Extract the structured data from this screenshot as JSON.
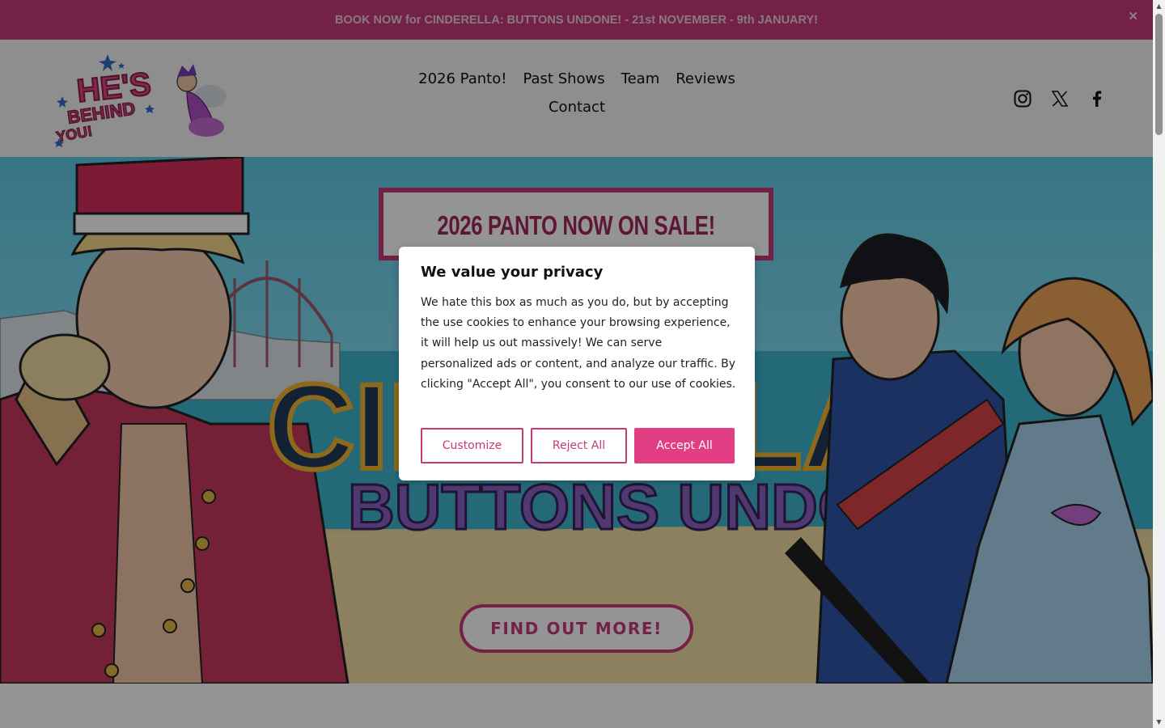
{
  "announcement": {
    "text": "BOOK NOW for CINDERELLA: BUTTONS UNDONE! - 21st NOVEMBER - 9th JANUARY!",
    "close_icon": "close-icon"
  },
  "header": {
    "logo_text": [
      "HE'S",
      "BEHIND",
      "YOU!"
    ],
    "nav": [
      "2026 Panto!",
      "Past Shows",
      "Team",
      "Reviews",
      "Contact"
    ],
    "socials": [
      "instagram-icon",
      "x-icon",
      "facebook-icon"
    ]
  },
  "hero": {
    "sale_banner": "2026 PANTO NOW ON SALE!",
    "show_title_line1": "CINDERELLA",
    "show_title_line2": "BUTTONS UNDONE!",
    "cta_label": "FIND OUT MORE!"
  },
  "cookie_modal": {
    "title": "We value your privacy",
    "body": "We hate this box as much as you do, but by accepting the use cookies to enhance your browsing experience, it will help us out massively! We can serve personalized ads or content, and analyze our traffic. By clicking \"Accept All\", you consent to our use of cookies.",
    "buttons": {
      "customize": "Customize",
      "reject": "Reject All",
      "accept": "Accept All"
    }
  },
  "colors": {
    "brand_pink": "#c73a7a",
    "accept_pink": "#e23e84",
    "sale_text": "#a4285e"
  }
}
